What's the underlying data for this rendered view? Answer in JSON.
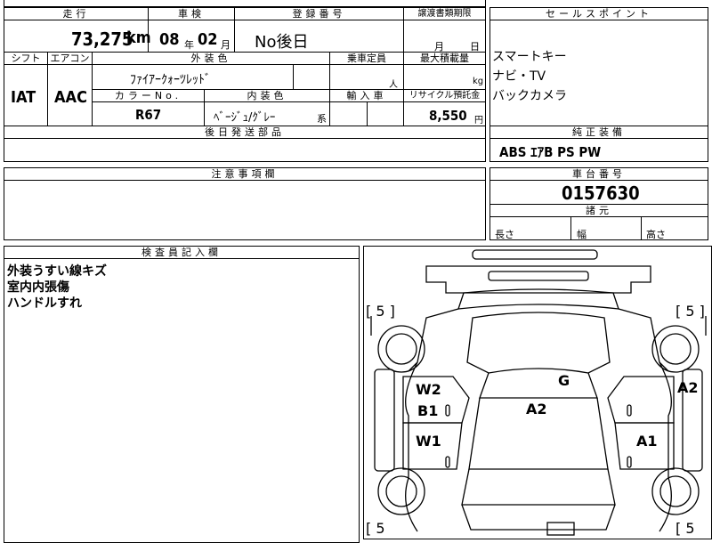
{
  "headers": {
    "mileage": "走行",
    "inspection": "車検",
    "registration": "登録番号",
    "transfer_docs": "譲渡書類期限",
    "sales_points": "セールスポイント",
    "shift": "シフト",
    "aircon": "エアコン",
    "exterior_color": "外装色",
    "capacity": "乗車定員",
    "max_load": "最大積載量",
    "color_no": "カラーNo.",
    "interior_color": "内装色",
    "import": "輸入車",
    "recycle": "リサイクル預託金",
    "later_parts": "後日発送部品",
    "standard_equipment": "純正装備",
    "notes": "注意事項欄",
    "chassis_no": "車台番号",
    "specs": "諸元",
    "inspector_notes": "検査員記入欄"
  },
  "values": {
    "mileage": "73,275",
    "mileage_unit": "km",
    "inspection_year": "08",
    "inspection_year_unit": "年",
    "inspection_month": "02",
    "inspection_month_unit": "月",
    "registration": "No後日",
    "transfer_month_unit": "月",
    "transfer_day_unit": "日",
    "shift": "IAT",
    "aircon": "AAC",
    "exterior_color": "ﾌｧｲｱｰｸｫｰﾂﾚｯﾄﾞ",
    "capacity_unit": "人",
    "max_load_unit": "kg",
    "color_no": "R67",
    "interior_color": "ﾍﾞｰｼﾞｭ/ｸﾞﾚｰ",
    "interior_color_suffix": "系",
    "recycle": "8,550",
    "recycle_unit": "円",
    "sales_points": [
      "スマートキー",
      "ナビ・TV",
      "バックカメラ"
    ],
    "standard_equipment": "ABS ｴｱB PS PW",
    "chassis_no": "0157630",
    "length": "長さ",
    "width": "幅",
    "height": "高さ",
    "inspector_notes": [
      "外装うすい線キズ",
      "室内内張傷",
      "ハンドルすれ"
    ]
  },
  "diagram": {
    "rating_left_top": "[ 5 ]",
    "rating_right_top": "[ 5 ]",
    "rating_left_bottom": "[ 5",
    "rating_right_bottom": "[ 5",
    "damage": {
      "w2": "W2",
      "b1": "B1",
      "w1": "W1",
      "a2_center": "A2",
      "g": "G",
      "a2_right": "A2",
      "a1": "A1"
    }
  }
}
